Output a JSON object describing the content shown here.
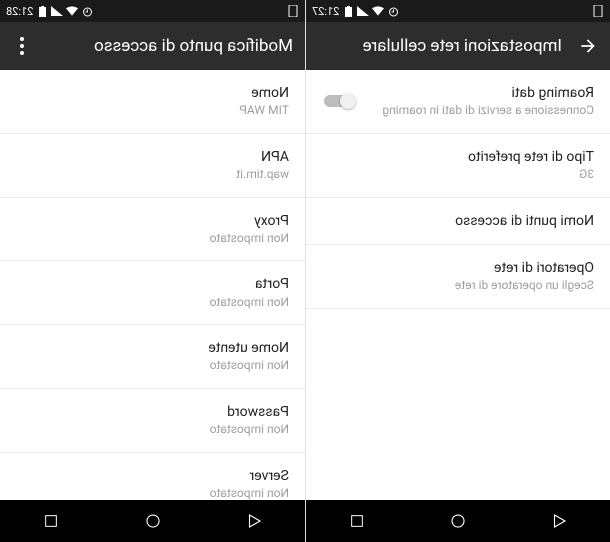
{
  "left": {
    "statusbar": {
      "time": "21:27"
    },
    "appbar": {
      "title": "Impostazioni rete cellulare"
    },
    "rows": [
      {
        "title": "Roaming dati",
        "sub": "Connessione a servizi di dati in roaming",
        "toggle": true
      },
      {
        "title": "Tipo di rete preferito",
        "sub": "3G"
      },
      {
        "title": "Nomi punti di accesso",
        "sub": ""
      },
      {
        "title": "Operatori di rete",
        "sub": "Scegli un operatore di rete"
      }
    ]
  },
  "right": {
    "statusbar": {
      "time": "21:28"
    },
    "appbar": {
      "title": "Modifica punto di accesso"
    },
    "rows": [
      {
        "title": "Nome",
        "sub": "TIM WAP"
      },
      {
        "title": "APN",
        "sub": "wap.tim.it"
      },
      {
        "title": "Proxy",
        "sub": "Non impostato"
      },
      {
        "title": "Porta",
        "sub": "Non impostato"
      },
      {
        "title": "Nome utente",
        "sub": "Non impostato"
      },
      {
        "title": "Password",
        "sub": "Non impostato"
      },
      {
        "title": "Server",
        "sub": "Non impostato"
      }
    ]
  }
}
